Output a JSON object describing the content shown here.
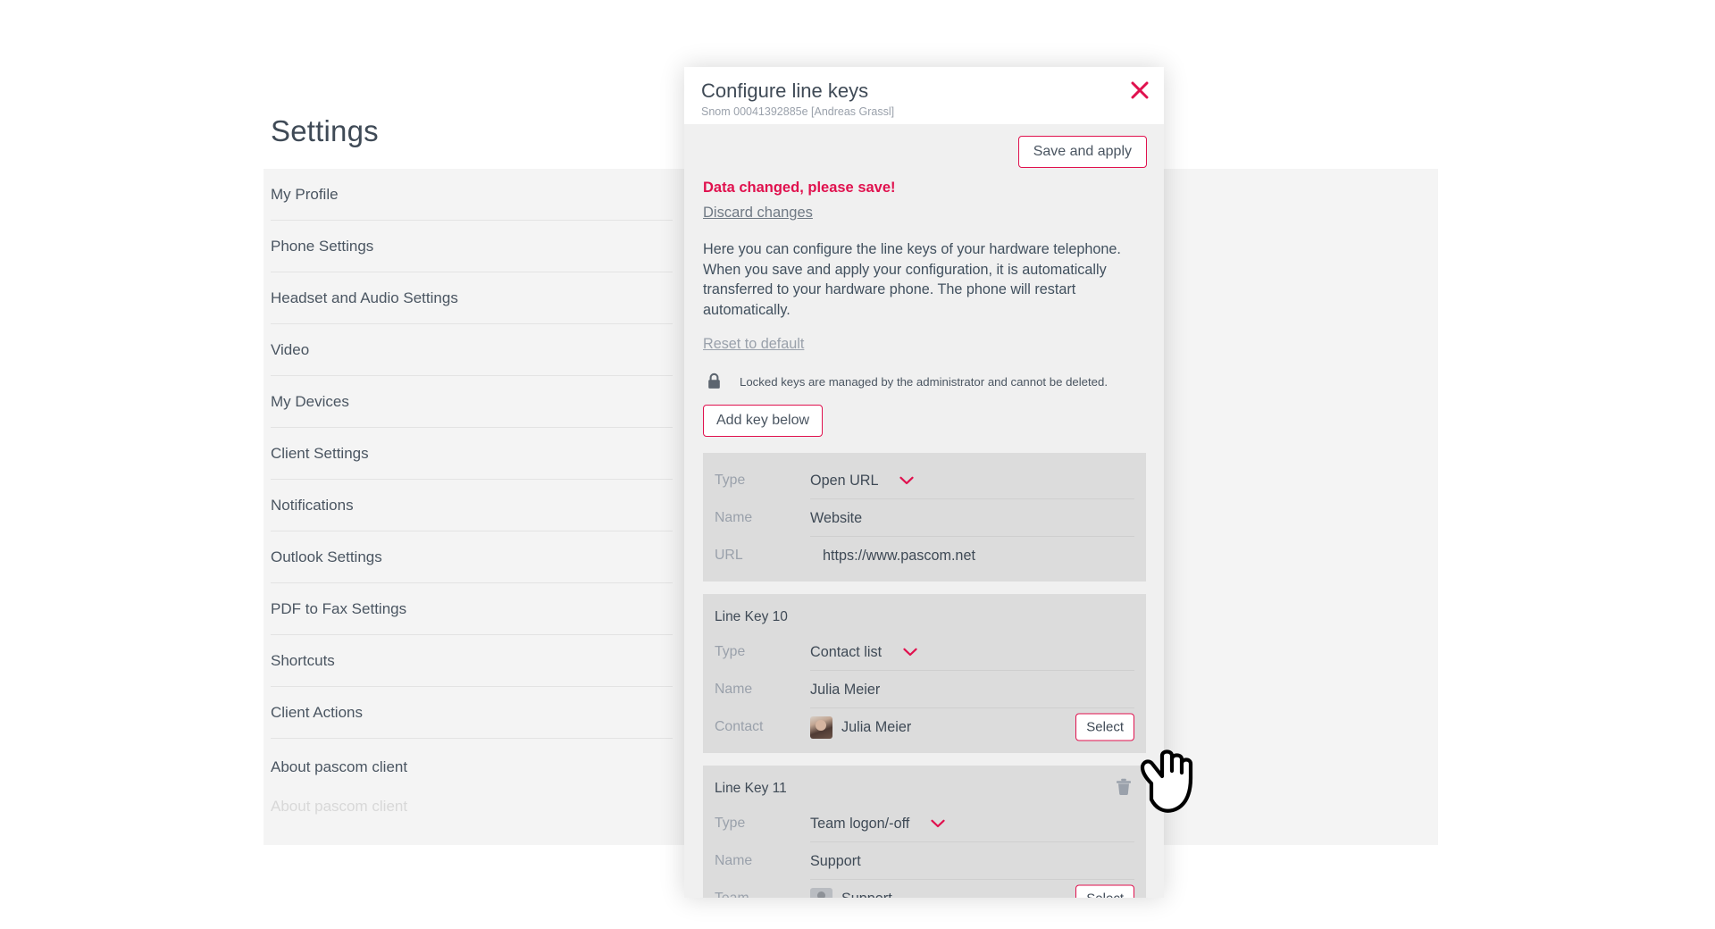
{
  "page": {
    "title": "Settings",
    "sidebar_items": [
      {
        "label": "My Profile"
      },
      {
        "label": "Phone Settings"
      },
      {
        "label": "Headset and Audio Settings"
      },
      {
        "label": "Video"
      },
      {
        "label": "My Devices"
      },
      {
        "label": "Client Settings"
      },
      {
        "label": "Notifications"
      },
      {
        "label": "Outlook Settings"
      },
      {
        "label": "PDF to Fax Settings"
      },
      {
        "label": "Shortcuts"
      },
      {
        "label": "Client Actions"
      },
      {
        "label": "About pascom client"
      }
    ]
  },
  "modal": {
    "title": "Configure line keys",
    "subtitle": "Snom 00041392885e [Andreas Grassl]",
    "close_icon": "close-icon",
    "save_and_apply_label": "Save and apply",
    "alert_text": "Data changed, please save!",
    "discard_label": "Discard changes",
    "description": "Here you can configure the line keys of your hardware telephone. When you save and apply your configuration, it is automatically transferred to your hardware phone. The phone will restart automatically.",
    "reset_label": "Reset to default",
    "locked_icon": "lock-icon",
    "locked_note": "Locked keys are managed by the administrator and cannot be deleted.",
    "add_key_label": "Add key below",
    "labels": {
      "type": "Type",
      "name": "Name",
      "url": "URL",
      "contact": "Contact",
      "team": "Team",
      "select": "Select"
    },
    "keys": [
      {
        "title": "",
        "type_value": "Open URL",
        "name_value": "Website",
        "extra_label": "URL",
        "extra_value": "https://www.pascom.net",
        "extra_kind": "text",
        "has_select": false,
        "has_trash": false
      },
      {
        "title": "Line Key 10",
        "type_value": "Contact list",
        "name_value": "Julia Meier",
        "extra_label": "Contact",
        "extra_value": "Julia Meier",
        "extra_kind": "photo",
        "has_select": true,
        "has_trash": false
      },
      {
        "title": "Line Key 11",
        "type_value": "Team logon/-off",
        "name_value": "Support",
        "extra_label": "Team",
        "extra_value": "Support",
        "extra_kind": "generic",
        "has_select": true,
        "has_trash": true
      }
    ]
  },
  "colors": {
    "accent": "#e0114e",
    "text": "#3f4a56",
    "muted": "#9aa1ab",
    "panel": "#f4f4f4",
    "card": "#dcdcdc",
    "modal_body": "#f0f0f0"
  },
  "cursor": {
    "icon": "pointing-hand-cursor"
  }
}
